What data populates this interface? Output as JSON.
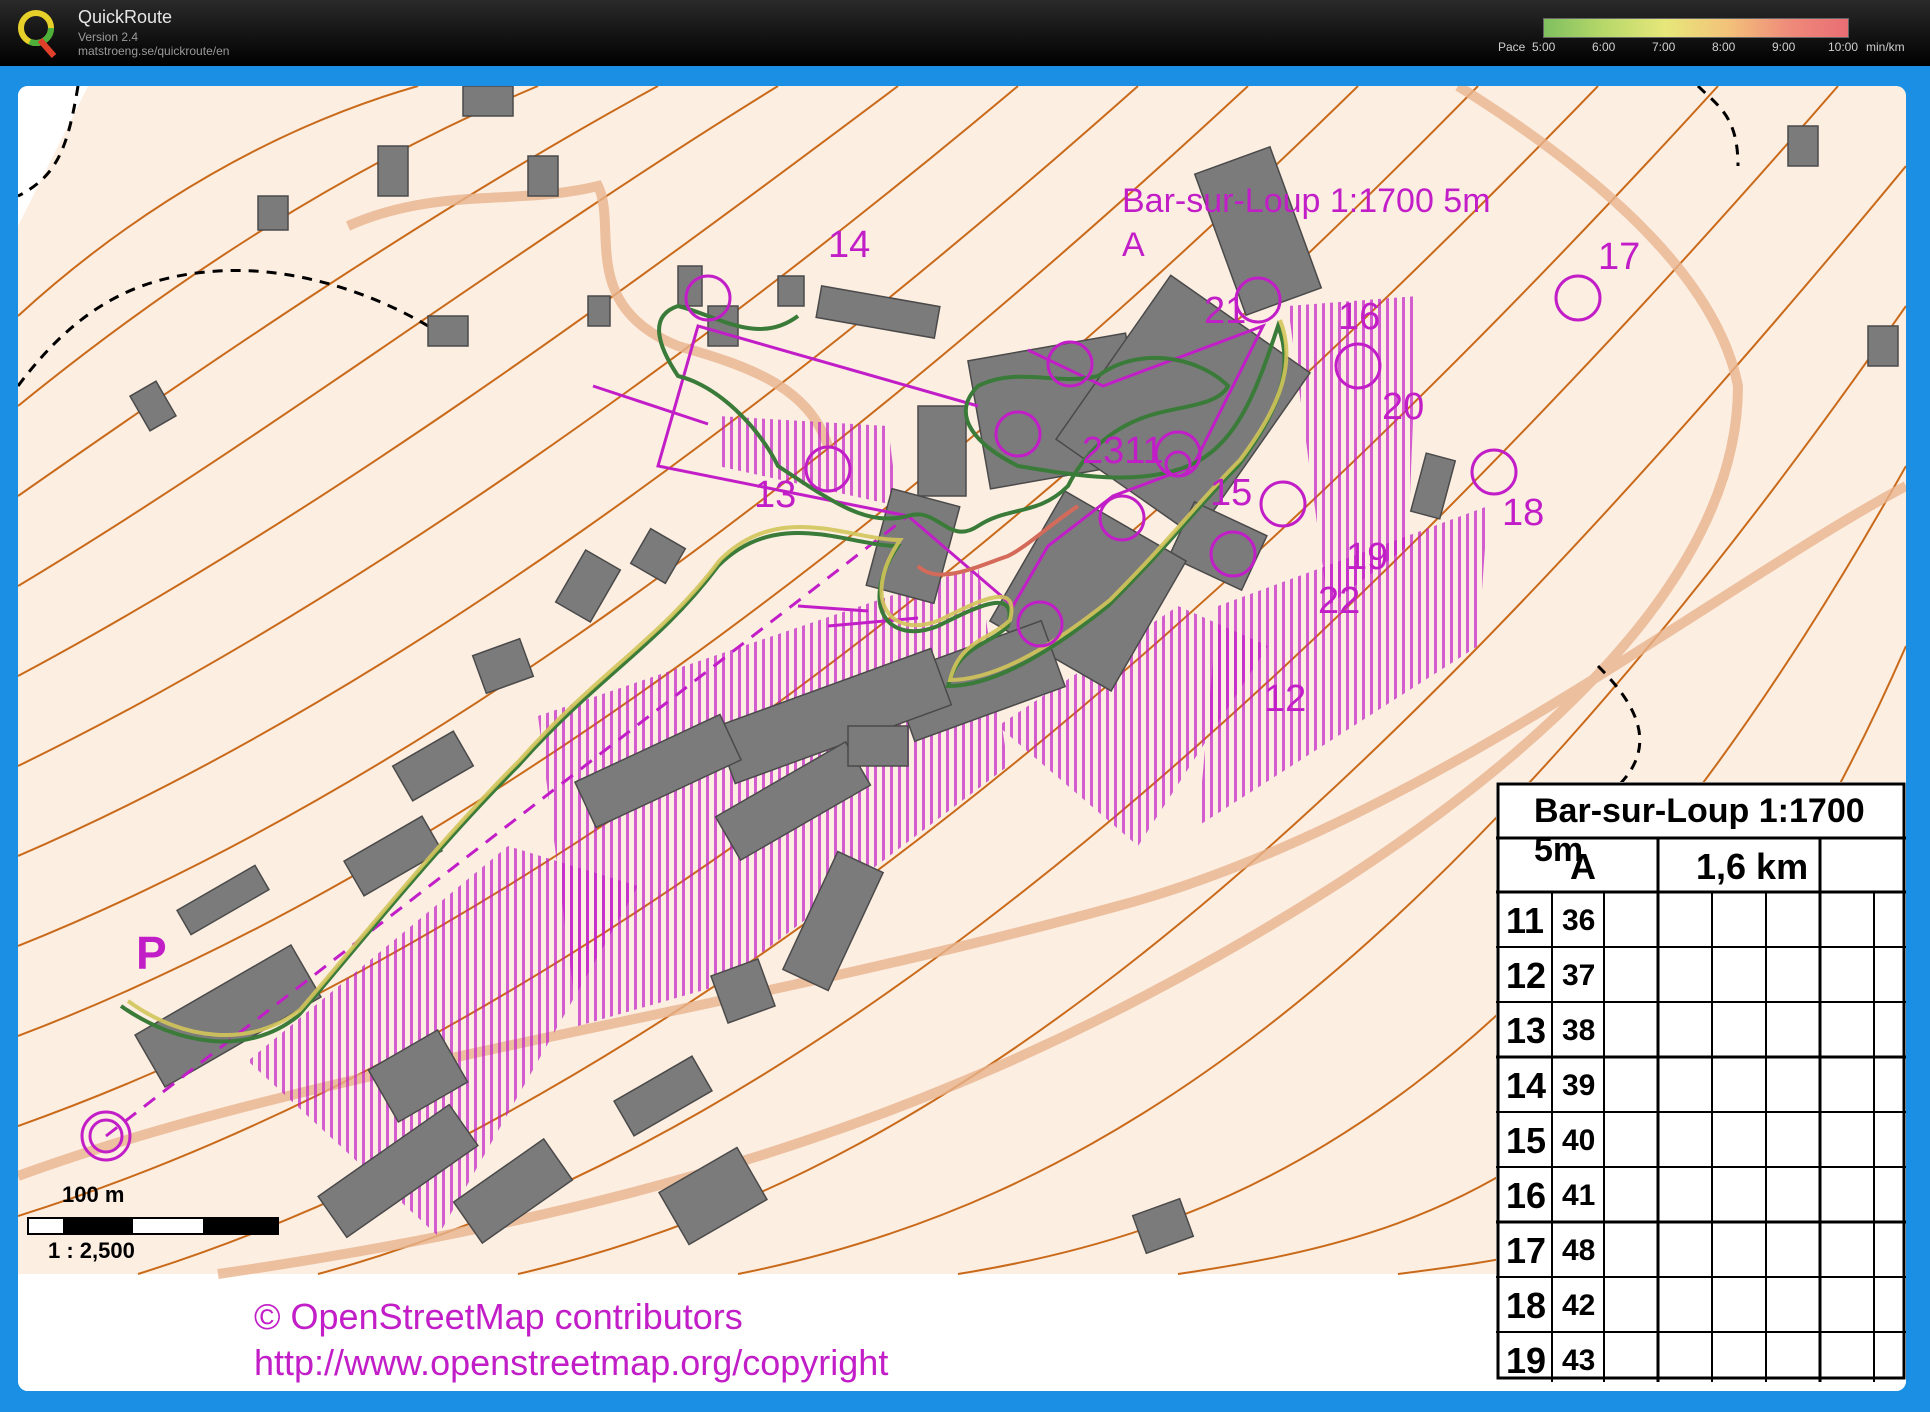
{
  "app": {
    "title": "QuickRoute",
    "version": "Version 2.4",
    "url": "matstroeng.se/quickroute/en",
    "pace_label": "Pace",
    "pace_ticks": [
      "5:00",
      "6:00",
      "7:00",
      "8:00",
      "9:00",
      "10:00"
    ],
    "pace_unit": "min/km"
  },
  "map": {
    "title": "Bar-sur-Loup 1:1700 5m",
    "class": "A",
    "start_label": "P",
    "controls": [
      {
        "label": "14"
      },
      {
        "label": "21"
      },
      {
        "label": "16"
      },
      {
        "label": "17"
      },
      {
        "label": "20"
      },
      {
        "label": "2311"
      },
      {
        "label": "15"
      },
      {
        "label": "13"
      },
      {
        "label": "18"
      },
      {
        "label": "19"
      },
      {
        "label": "22"
      },
      {
        "label": "12"
      }
    ],
    "scale_distance": "100 m",
    "scale_ratio": "1 : 2,500",
    "credit_line1": "© OpenStreetMap contributors",
    "credit_line2": "http://www.openstreetmap.org/copyright",
    "colors": {
      "course": "#c21ec8",
      "paper": "#fdeee2",
      "contour": "#c96a1a",
      "building": "#7b7b7b",
      "frame": "#1a8fe3"
    }
  },
  "descriptions": {
    "title": "Bar-sur-Loup 1:1700 5m",
    "class": "A",
    "length": "1,6 km",
    "rows": [
      {
        "no": "11",
        "code": "36"
      },
      {
        "no": "12",
        "code": "37"
      },
      {
        "no": "13",
        "code": "38"
      },
      {
        "no": "14",
        "code": "39"
      },
      {
        "no": "15",
        "code": "40"
      },
      {
        "no": "16",
        "code": "41"
      },
      {
        "no": "17",
        "code": "48"
      },
      {
        "no": "18",
        "code": "42"
      },
      {
        "no": "19",
        "code": "43"
      }
    ]
  }
}
